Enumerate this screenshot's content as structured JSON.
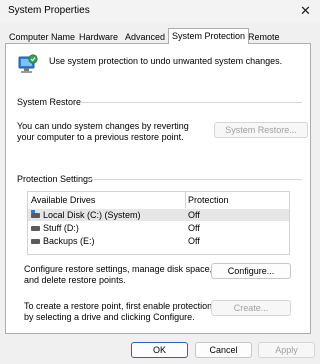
{
  "window": {
    "title": "System Properties",
    "close_glyph": "✕"
  },
  "tabs": [
    {
      "label": "Computer Name",
      "active": false
    },
    {
      "label": "Hardware",
      "active": false
    },
    {
      "label": "Advanced",
      "active": false
    },
    {
      "label": "System Protection",
      "active": true
    },
    {
      "label": "Remote",
      "active": false
    }
  ],
  "intro": {
    "text": "Use system protection to undo unwanted system changes.",
    "icon": "system-protection-icon"
  },
  "system_restore": {
    "heading": "System Restore",
    "description_line1": "You can undo system changes by reverting",
    "description_line2": "your computer to a previous restore point.",
    "button": "System Restore..."
  },
  "protection": {
    "heading": "Protection Settings",
    "columns": [
      "Available Drives",
      "Protection"
    ],
    "drives": [
      {
        "name": "Local Disk (C:) (System)",
        "protection": "Off",
        "selected": true,
        "icon": "system-drive-icon"
      },
      {
        "name": "Stuff (D:)",
        "protection": "Off",
        "selected": false,
        "icon": "drive-icon"
      },
      {
        "name": "Backups (E:)",
        "protection": "Off",
        "selected": false,
        "icon": "drive-icon"
      }
    ],
    "configure_text_line1": "Configure restore settings, manage disk space,",
    "configure_text_line2": "and delete restore points.",
    "configure_button": "Configure...",
    "create_text_line1": "To create a restore point, first enable protection",
    "create_text_line2": "by selecting a drive and clicking Configure.",
    "create_button": "Create..."
  },
  "footer": {
    "ok": "OK",
    "cancel": "Cancel",
    "apply": "Apply"
  }
}
